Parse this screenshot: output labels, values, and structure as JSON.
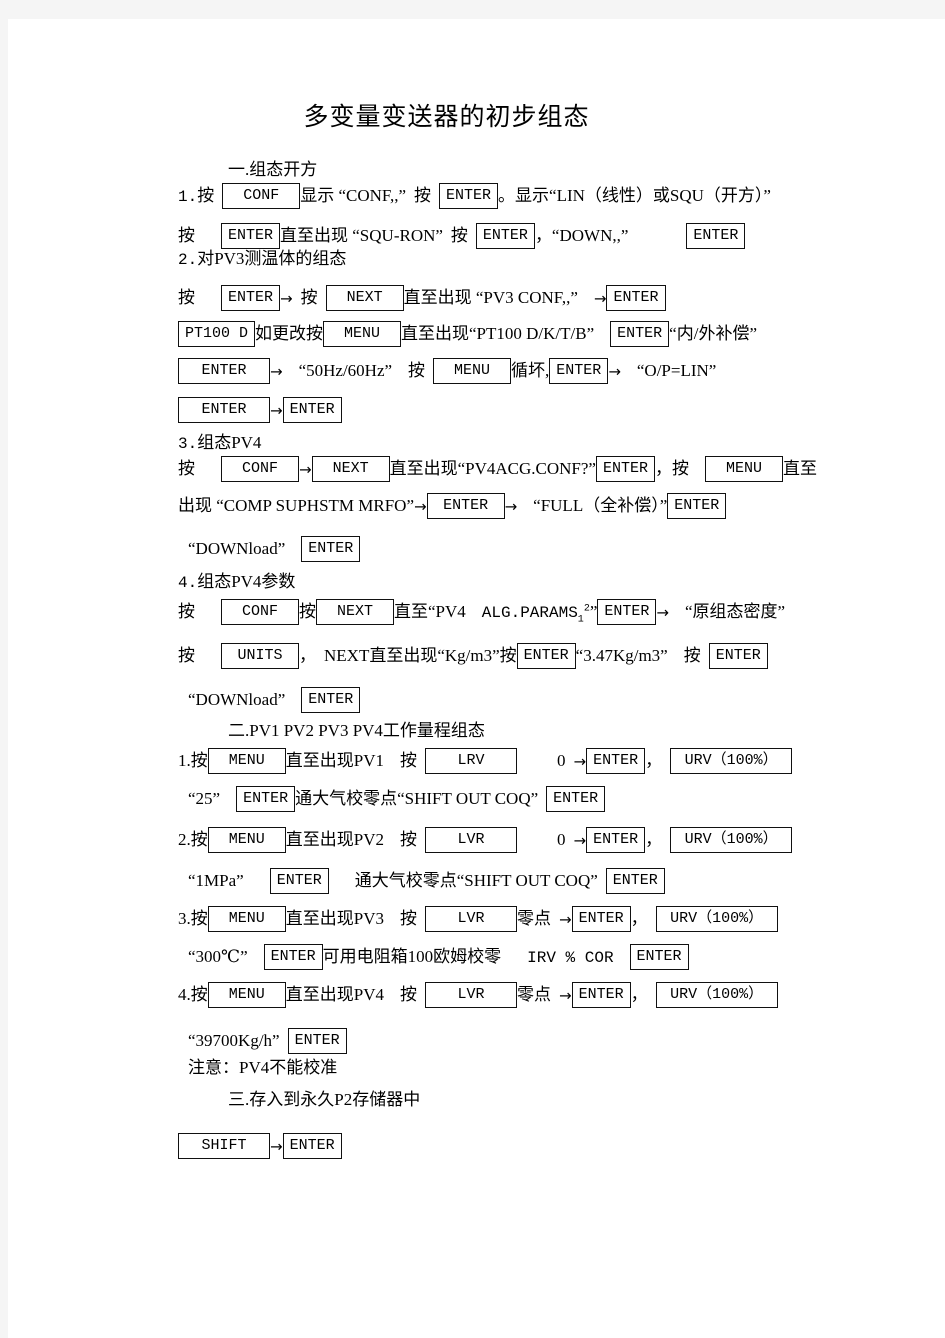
{
  "document": {
    "title": "多变量变送器的初步组态",
    "sections": [
      {
        "heading": "一.组态开方",
        "items": [
          {
            "number": "1.",
            "lines": [
              {
                "parts": [
                  "按",
                  "KEY:CONF",
                  "显示 “CONF,,”",
                  "按",
                  "KEY:ENTER",
                  "。显示“LIN（线性）或SQU（开方）”"
                ]
              },
              {
                "parts": [
                  "按",
                  "KEY:ENTER",
                  "直至出现 “SQU-RON”",
                  "按",
                  "KEY:ENTER",
                  "，“DOWN,,”",
                  "KEY:ENTER"
                ]
              }
            ]
          },
          {
            "number": "2.",
            "label": "对PV3测温体的组态",
            "lines": [
              {
                "parts": [
                  "按",
                  "KEY:ENTER",
                  "→",
                  "按",
                  "KEY:NEXT",
                  "直至出现 “PV3 CONF,,”",
                  "→",
                  "KEY:ENTER"
                ]
              },
              {
                "parts": [
                  "KEY:PT100 D",
                  "如更改按",
                  "KEY:MENU",
                  "直至出现“PT100 D/K/T/B”",
                  "KEY:ENTER",
                  "“内/外补偿”"
                ]
              },
              {
                "parts": [
                  "KEY:ENTER",
                  "→",
                  "“50Hz/60Hz”",
                  "按",
                  "KEY:MENU",
                  "循坏,",
                  "KEY:ENTER",
                  "→",
                  "“O/P=LIN”"
                ]
              },
              {
                "parts": [
                  "KEY:ENTER",
                  "→",
                  "KEY:ENTER"
                ]
              }
            ]
          },
          {
            "number": "3.",
            "label": "组态PV4",
            "lines": [
              {
                "parts": [
                  "按",
                  "KEY:CONF",
                  "→",
                  "KEY:NEXT",
                  "直至出现“PV4ACG.CONF?”",
                  "KEY:ENTER",
                  "，按",
                  "KEY:MENU",
                  "直至"
                ]
              },
              {
                "parts": [
                  "出现 “COMP SUPHSTM MRFO”",
                  "→",
                  "KEY:ENTER",
                  "→",
                  "“FULL（全补偿）”",
                  "KEY:ENTER"
                ]
              },
              {
                "parts": [
                  "“DOWNload”",
                  "KEY:ENTER"
                ]
              }
            ]
          },
          {
            "number": "4.",
            "label": "组态PV4参数",
            "lines": [
              {
                "parts": [
                  "按",
                  "KEY:CONF",
                  "按",
                  "KEY:NEXT",
                  "直至“PV4  ALG.PARAMS₁²”",
                  "KEY:ENTER",
                  "→",
                  "“原组态密度”"
                ]
              },
              {
                "parts": [
                  "按",
                  "KEY:UNITS",
                  "，",
                  "NEXT直至出现“Kg/m3”按",
                  "KEY:ENTER",
                  "“3.47Kg/m3”",
                  "按",
                  "KEY:ENTER"
                ]
              },
              {
                "parts": [
                  "“DOWNload”",
                  "KEY:ENTER"
                ]
              }
            ]
          }
        ]
      },
      {
        "heading": "二.PV1 PV2 PV3  PV4工作量程组态",
        "items": [
          {
            "number": "1.",
            "lines": [
              {
                "parts": [
                  "按",
                  "KEY:MENU",
                  "直至出现PV1",
                  "按",
                  "KEY:LRV",
                  "0",
                  "→",
                  "KEY:ENTER",
                  "，",
                  "KEY:URV（100%）"
                ]
              },
              {
                "parts": [
                  "“25”",
                  "KEY:ENTER",
                  "通大气校零点“SHIFT OUT COQ”",
                  "KEY:ENTER"
                ]
              }
            ]
          },
          {
            "number": "2.",
            "lines": [
              {
                "parts": [
                  "按",
                  "KEY:MENU",
                  "直至出现PV2",
                  "按",
                  "KEY:LVR",
                  "0",
                  "→",
                  "KEY:ENTER",
                  "，",
                  "KEY:URV（100%）"
                ]
              },
              {
                "parts": [
                  "“1MPa”",
                  "KEY:ENTER",
                  "通大气校零点“SHIFT OUT COQ”",
                  "KEY:ENTER"
                ]
              }
            ]
          },
          {
            "number": "3.",
            "lines": [
              {
                "parts": [
                  "按",
                  "KEY:MENU",
                  "直至出现PV3",
                  "按",
                  "KEY:LVR",
                  "零点",
                  "→",
                  "KEY:ENTER",
                  "，",
                  "KEY:URV（100%）"
                ]
              },
              {
                "parts": [
                  "“300℃”",
                  "KEY:ENTER",
                  "可用电阻箱100欧姆校零",
                  "IRV % COR",
                  "KEY:ENTER"
                ]
              }
            ]
          },
          {
            "number": "4.",
            "lines": [
              {
                "parts": [
                  "按",
                  "KEY:MENU",
                  "直至出现PV4",
                  "按",
                  "KEY:LVR",
                  "零点",
                  "→",
                  "KEY:ENTER",
                  "，",
                  "KEY:URV（100%）"
                ]
              },
              {
                "parts": [
                  "“39700Kg/h”",
                  "KEY:ENTER"
                ]
              },
              {
                "parts": [
                  "注意：PV4不能校准"
                ]
              }
            ]
          }
        ]
      },
      {
        "heading": "三.存入到永久P2存储器中",
        "items": [
          {
            "lines": [
              {
                "parts": [
                  "KEY:SHIFT",
                  "→",
                  "KEY:ENTER"
                ]
              }
            ]
          }
        ]
      }
    ]
  },
  "lines": {
    "sec1_head": "一.组态开方",
    "l1_num": "1.",
    "l1_a": "按",
    "l1_k1": "CONF",
    "l1_b": "显示 “CONF,,”",
    "l1_c": "按",
    "l1_k2": "ENTER",
    "l1_d": "。显示“LIN（线性）或SQU（开方）”",
    "l2_a": "按",
    "l2_k1": "ENTER",
    "l2_b": "直至出现 “SQU-RON”",
    "l2_c": "按",
    "l2_k2": "ENTER",
    "l2_d": "，“DOWN,,”",
    "l2_k3": "ENTER",
    "l3_num": "2.",
    "l3_label": "对PV3测温体的组态",
    "l4_a": "按",
    "l4_k1": "ENTER",
    "l4_ar1": "→",
    "l4_b": "按",
    "l4_k2": "NEXT",
    "l4_c": "直至出现 “PV3 CONF,,”",
    "l4_ar2": "→",
    "l4_k3": "ENTER",
    "l5_k1": "PT100 D",
    "l5_a": "如更改按",
    "l5_k2": "MENU",
    "l5_b": "直至出现“PT100 D/K/T/B”",
    "l5_k3": "ENTER",
    "l5_c": "“内/外补偿”",
    "l6_k1": "ENTER",
    "l6_ar1": "→",
    "l6_a": "“50Hz/60Hz”",
    "l6_b": "按",
    "l6_k2": "MENU",
    "l6_c": "循坏,",
    "l6_k3": "ENTER",
    "l6_ar2": "→",
    "l6_d": "“O/P=LIN”",
    "l7_k1": "ENTER",
    "l7_ar1": "→",
    "l7_k2": "ENTER",
    "l8_num": "3.",
    "l8_label": "组态PV4",
    "l9_a": "按",
    "l9_k1": "CONF",
    "l9_ar1": "→",
    "l9_k2": "NEXT",
    "l9_b": "直至出现“PV4ACG.CONF?”",
    "l9_k3": "ENTER",
    "l9_c": "，按",
    "l9_k4": "MENU",
    "l9_d": "直至",
    "l10_a": "出现 “COMP SUPHSTM MRFO”",
    "l10_ar1": "→",
    "l10_k1": "ENTER",
    "l10_ar2": "→",
    "l10_b": "“FULL（全补偿）”",
    "l10_k2": "ENTER",
    "l11_a": "“DOWNload”",
    "l11_k1": "ENTER",
    "l12_num": "4.",
    "l12_label": "组态PV4参数",
    "l13_a": "按",
    "l13_k1": "CONF",
    "l13_b": "按",
    "l13_k2": "NEXT",
    "l13_c": "直至“PV4",
    "l13_c2": "ALG.PARAMS",
    "l13_sub": "1",
    "l13_sup": "2",
    "l13_c3": "”",
    "l13_k3": "ENTER",
    "l13_ar1": "→",
    "l13_d": "“原组态密度”",
    "l14_a": "按",
    "l14_k1": "UNITS",
    "l14_b": "，",
    "l14_c": "NEXT直至出现“Kg/m3”按",
    "l14_k2": "ENTER",
    "l14_d": "“3.47Kg/m3”",
    "l14_e": "按",
    "l14_k3": "ENTER",
    "l15_a": "“DOWNload”",
    "l15_k1": "ENTER",
    "sec2_head": "二.PV1 PV2 PV3  PV4工作量程组态",
    "l16_num": "1.按",
    "l16_k1": "MENU",
    "l16_a": "直至出现PV1",
    "l16_b": "按",
    "l16_k2": "LRV",
    "l16_c": "0",
    "l16_ar1": "→",
    "l16_k3": "ENTER",
    "l16_d": "，",
    "l16_k4": "URV（100%）",
    "l17_a": "“25”",
    "l17_k1": "ENTER",
    "l17_b": "通大气校零点“SHIFT OUT COQ”",
    "l17_k2": "ENTER",
    "l18_num": "2.按",
    "l18_k1": "MENU",
    "l18_a": "直至出现PV2",
    "l18_b": "按",
    "l18_k2": "LVR",
    "l18_c": "0",
    "l18_ar1": "→",
    "l18_k3": "ENTER",
    "l18_d": "，",
    "l18_k4": "URV（100%）",
    "l19_a": "“1MPa”",
    "l19_k1": "ENTER",
    "l19_b": "通大气校零点“SHIFT OUT COQ”",
    "l19_k2": "ENTER",
    "l20_num": "3.按",
    "l20_k1": "MENU",
    "l20_a": "直至出现PV3",
    "l20_b": "按",
    "l20_k2": "LVR",
    "l20_c": "零点",
    "l20_ar1": "→",
    "l20_k3": "ENTER",
    "l20_d": "，",
    "l20_k4": "URV（100%）",
    "l21_a": "“300℃”",
    "l21_k1": "ENTER",
    "l21_b": "可用电阻箱100欧姆校零",
    "l21_c": "IRV % COR",
    "l21_k2": "ENTER",
    "l22_num": "4.按",
    "l22_k1": "MENU",
    "l22_a": "直至出现PV4",
    "l22_b": "按",
    "l22_k2": "LVR",
    "l22_c": "零点",
    "l22_ar1": "→",
    "l22_k3": "ENTER",
    "l22_d": "，",
    "l22_k4": "URV（100%）",
    "l23_a": "“39700Kg/h”",
    "l23_k1": "ENTER",
    "l24_a": "注意：PV4不能校准",
    "sec3_head": "三.存入到永久P2存储器中",
    "l25_k1": "SHIFT",
    "l25_ar1": "→",
    "l25_k2": "ENTER"
  }
}
